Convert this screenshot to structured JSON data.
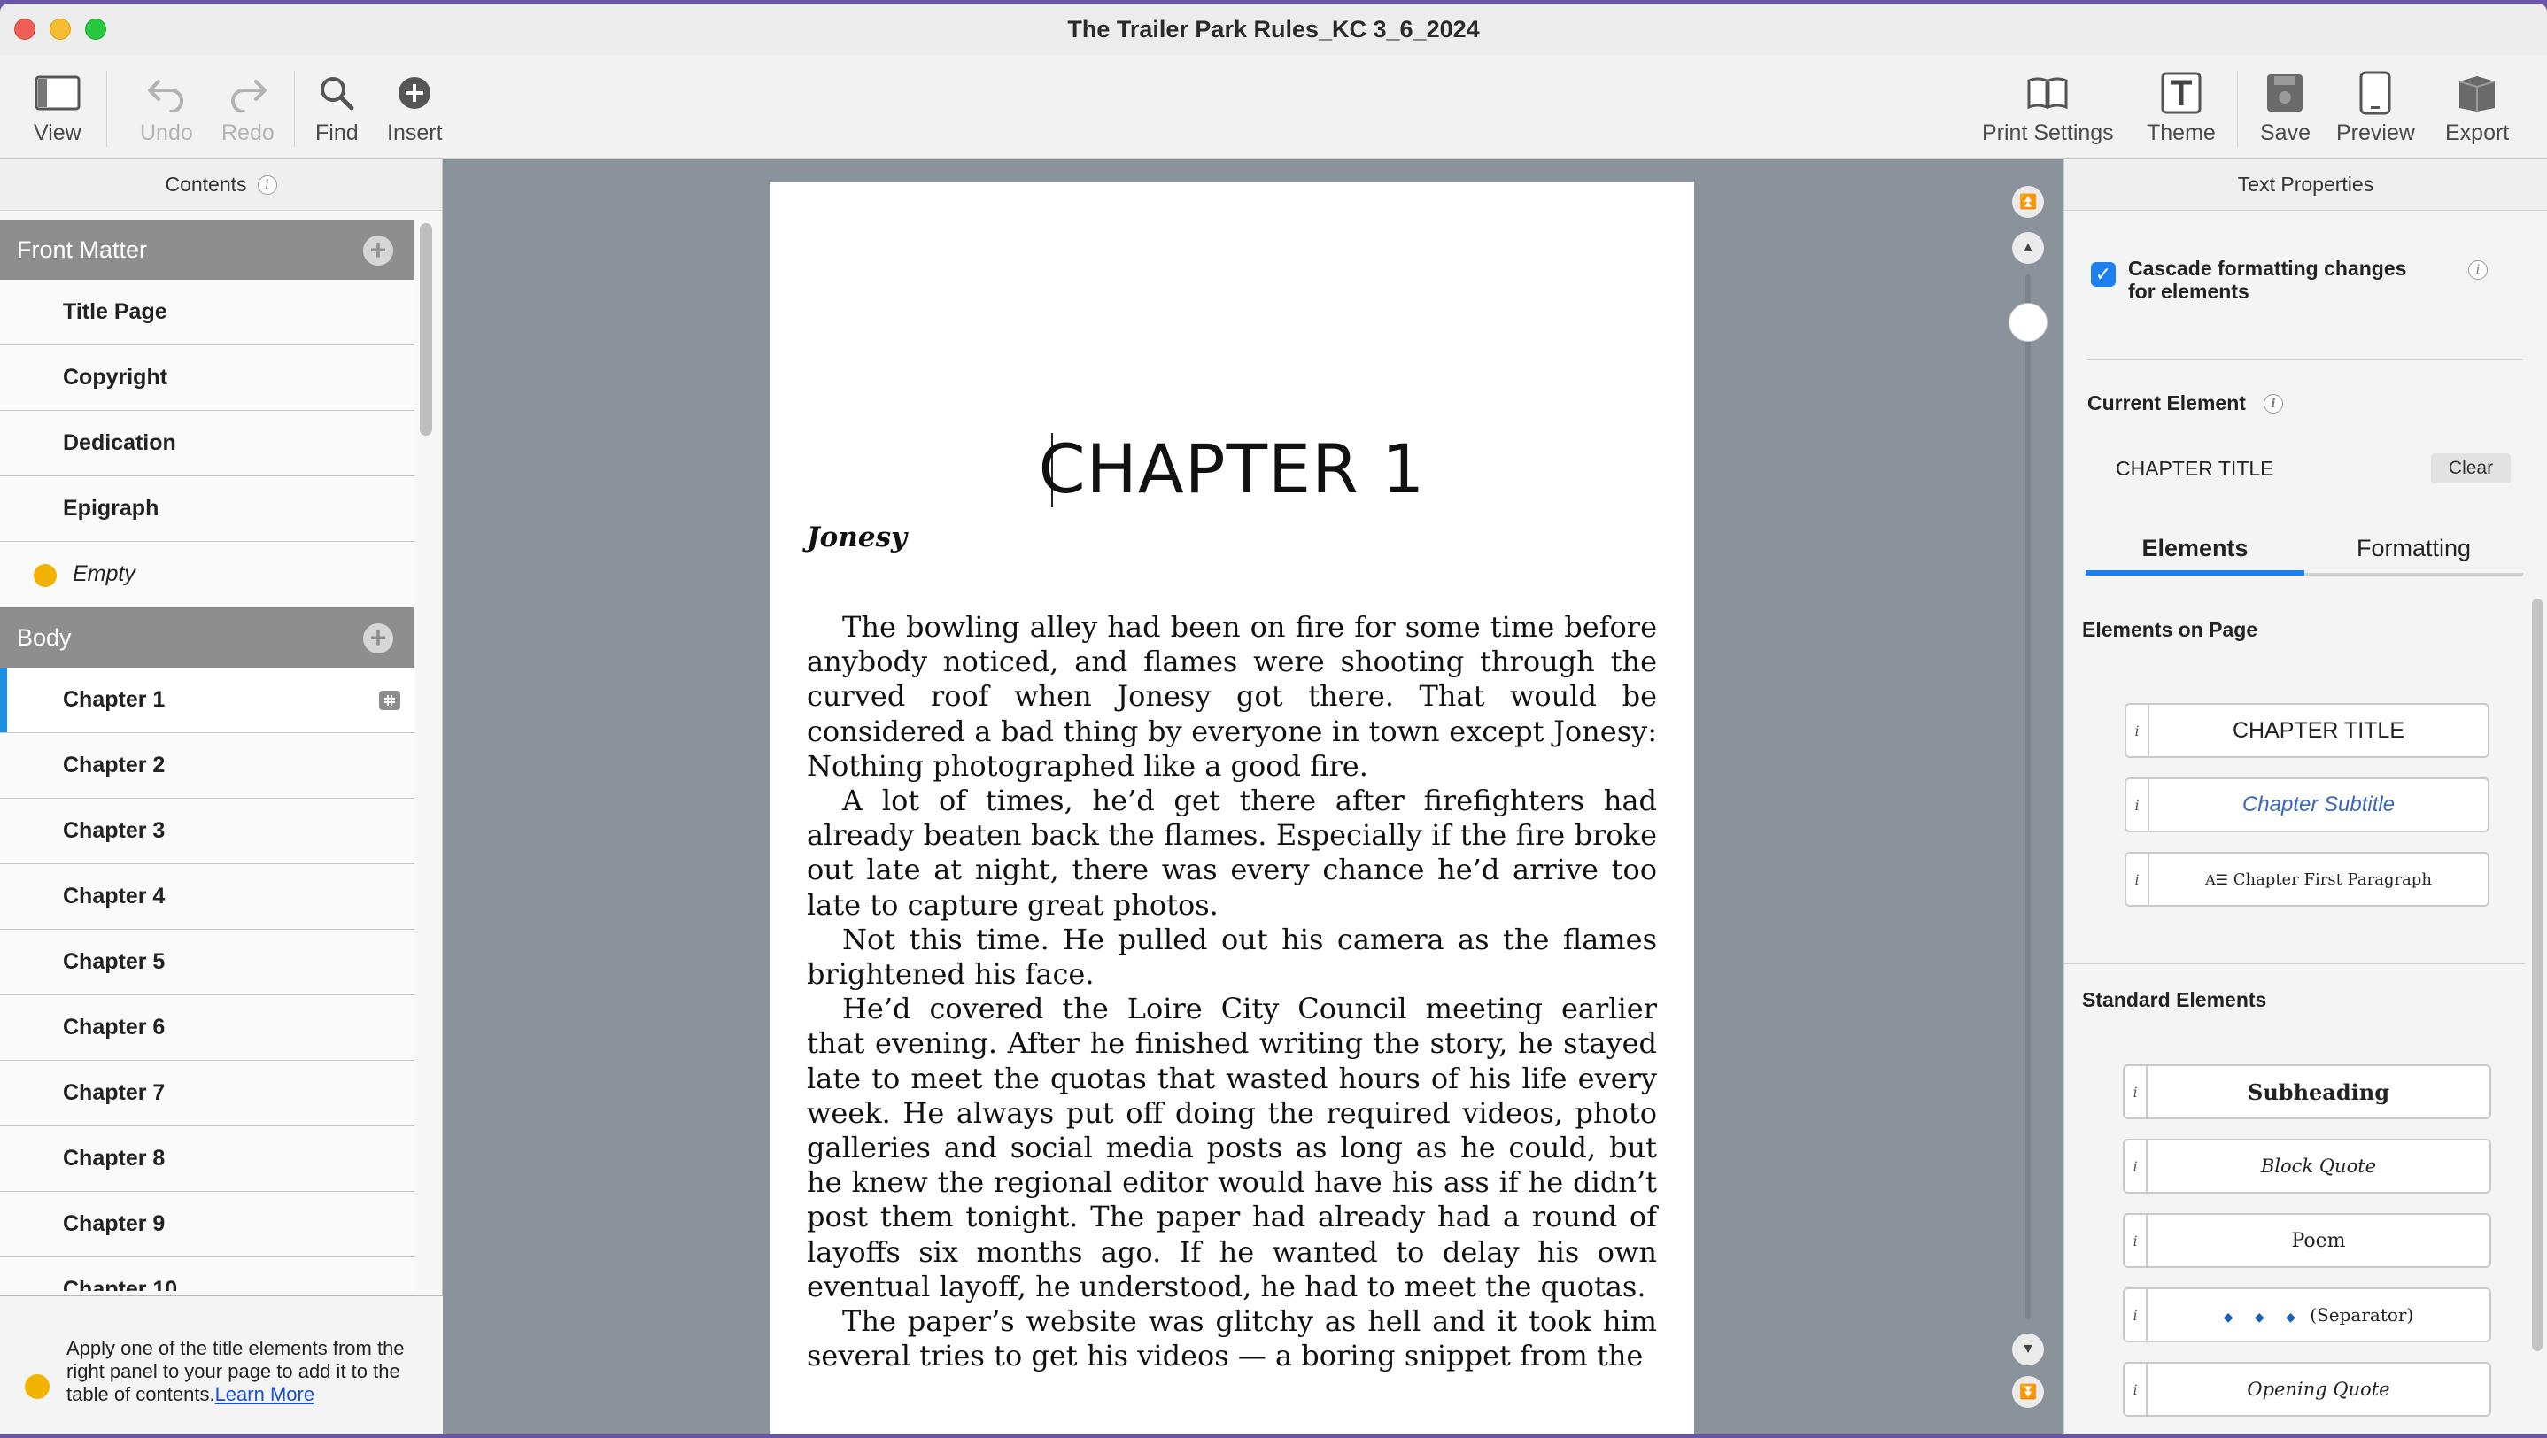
{
  "window": {
    "title": "The Trailer Park Rules_KC 3_6_2024"
  },
  "toolbar": {
    "view": "View",
    "undo": "Undo",
    "redo": "Redo",
    "find": "Find",
    "insert": "Insert",
    "print_settings": "Print Settings",
    "theme": "Theme",
    "save": "Save",
    "preview": "Preview",
    "export": "Export"
  },
  "contents": {
    "title": "Contents",
    "front_matter": {
      "label": "Front Matter",
      "items": [
        "Title Page",
        "Copyright",
        "Dedication",
        "Epigraph"
      ],
      "empty_label": "Empty"
    },
    "body": {
      "label": "Body",
      "items": [
        "Chapter 1",
        "Chapter 2",
        "Chapter 3",
        "Chapter 4",
        "Chapter 5",
        "Chapter 6",
        "Chapter 7",
        "Chapter 8",
        "Chapter 9",
        "Chapter 10"
      ],
      "selected": "Chapter 1"
    },
    "hint": "Apply one of the title elements from the right panel to your page to add it to the table of contents.",
    "learn_more": "Learn More"
  },
  "page": {
    "chapter_title": "CHAPTER 1",
    "chapter_subtitle": "Jonesy",
    "paragraphs": [
      "The bowling alley had been on fire for some time before anybody noticed, and flames were shooting through the curved roof when Jonesy got there. That would be considered a bad thing by everyone in town except Jonesy: Nothing photographed like a good fire.",
      "A lot of times, he’d get there after firefighters had already beaten back the flames. Especially if the fire broke out late at night, there was every chance he’d arrive too late to capture great photos.",
      "Not this time. He pulled out his camera as the flames brightened his face.",
      "He’d covered the Loire City Council meeting earlier that evening. After he finished writing the story, he stayed late to meet the quotas that wasted hours of his life every week. He always put off doing the required videos, photo galleries and social media posts as long as he could, but he knew the regional editor would have his ass if he didn’t post them tonight. The paper had already had a round of layoffs six months ago. If he wanted to delay his own eventual layoff, he understood, he had to meet the quotas.",
      "The paper’s website was glitchy as hell and it took him several tries to get his videos — a boring snippet from the"
    ]
  },
  "text_properties": {
    "title": "Text Properties",
    "cascade_label": "Cascade formatting changes for elements",
    "cascade_checked": true,
    "current_element_label": "Current Element",
    "current_element_value": "CHAPTER TITLE",
    "clear": "Clear",
    "tabs": [
      "Elements",
      "Formatting"
    ],
    "active_tab": "Elements",
    "elements_on_page_label": "Elements on Page",
    "elements_on_page": [
      "CHAPTER TITLE",
      "Chapter Subtitle",
      "Chapter First Paragraph"
    ],
    "standard_elements_label": "Standard Elements",
    "standard_elements": [
      "Subheading",
      "Block Quote",
      "Poem",
      "(Separator)",
      "Opening Quote"
    ],
    "separator_glyphs": "◆ ◆ ◆"
  },
  "colors": {
    "accent": "#1d7ff0",
    "empty_dot": "#f2b200",
    "section_header": "#8e8e8e",
    "canvas": "#8a929b",
    "subtitle_blue": "#3a68b8"
  }
}
